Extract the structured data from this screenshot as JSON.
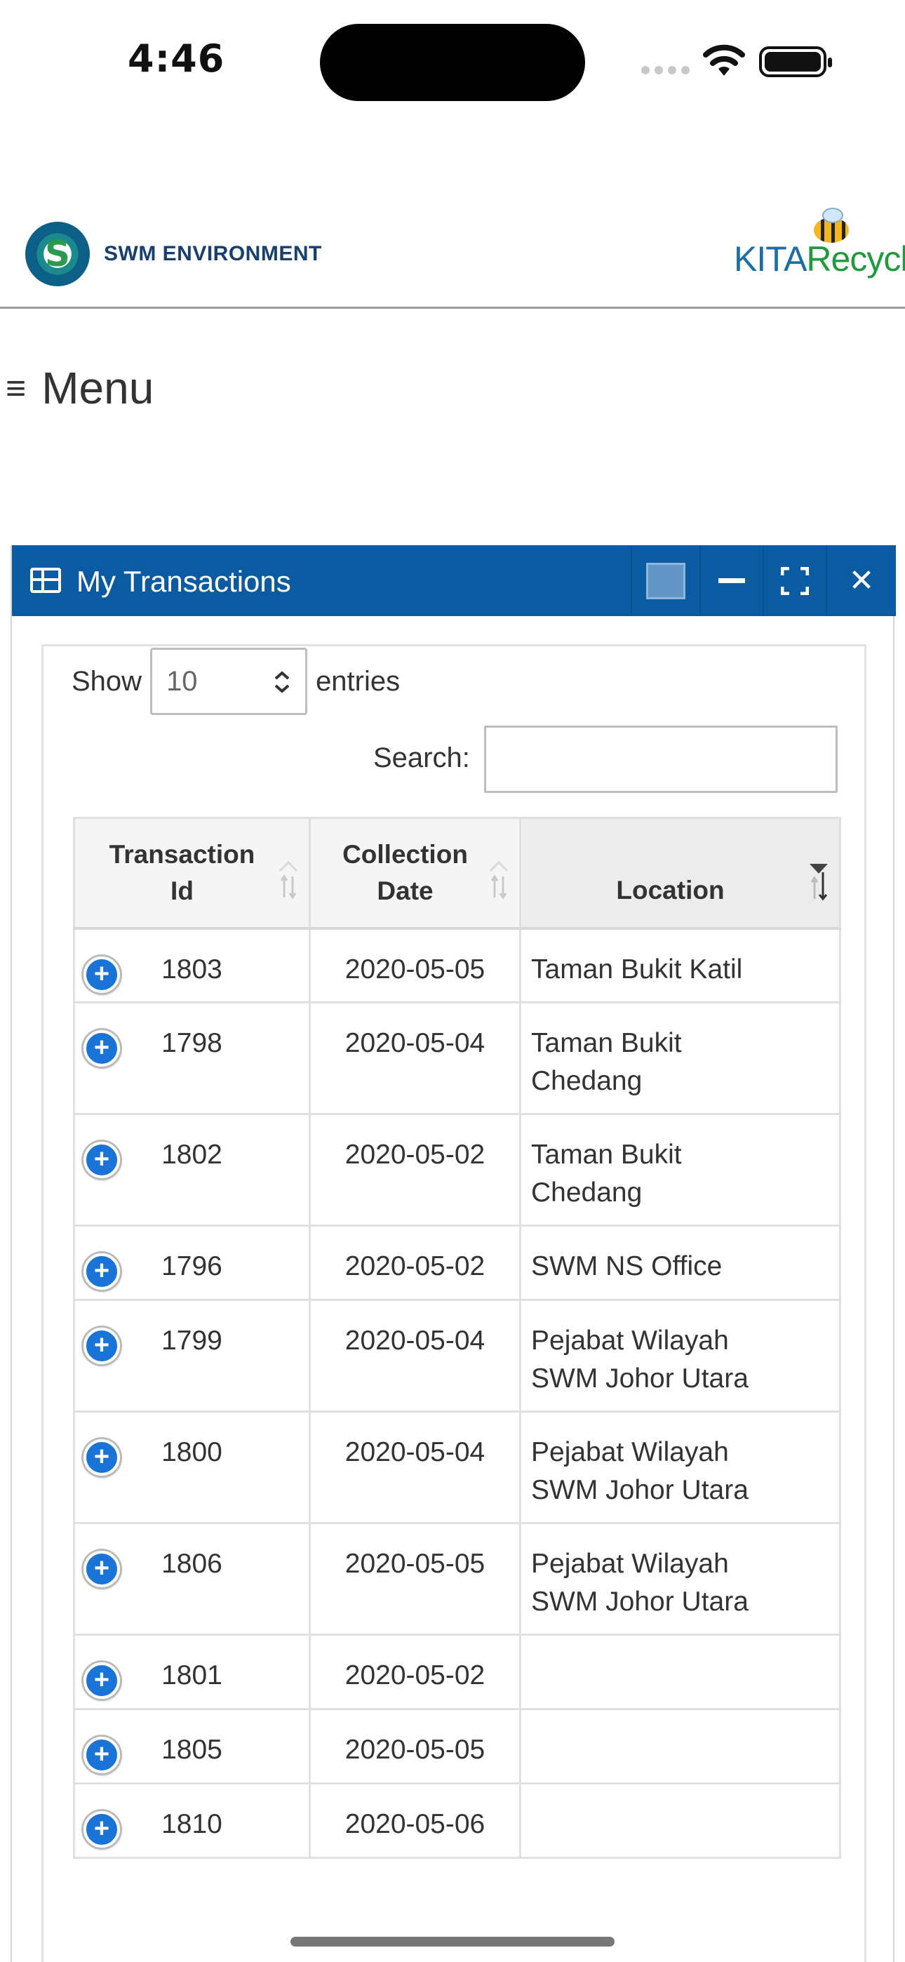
{
  "status_bar": {
    "time": "4:46"
  },
  "brand": {
    "left_logo_text": "SWM ENVIRONMENT",
    "right_logo_part1": "KITA",
    "right_logo_part2": "Recycle"
  },
  "menu": {
    "icon": "hamburger-icon",
    "label": "Menu"
  },
  "panel": {
    "title": "My Transactions",
    "header_color": "#0a5ba1",
    "controls": [
      "color-swatch",
      "minimize-icon",
      "maximize-icon",
      "close-icon"
    ]
  },
  "datatable": {
    "show_label": "Show",
    "page_length": "10",
    "entries_label": "entries",
    "search_label": "Search:",
    "search_value": "",
    "columns": [
      {
        "label_line1": "Transaction",
        "label_line2": "Id"
      },
      {
        "label_line1": "Collection",
        "label_line2": "Date"
      },
      {
        "label_line1": "Location",
        "label_line2": ""
      }
    ],
    "rows": [
      {
        "id": "1803",
        "date": "2020-05-05",
        "location_line1": "Taman Bukit Katil",
        "location_line2": ""
      },
      {
        "id": "1798",
        "date": "2020-05-04",
        "location_line1": "Taman Bukit",
        "location_line2": "Chedang"
      },
      {
        "id": "1802",
        "date": "2020-05-02",
        "location_line1": "Taman Bukit",
        "location_line2": "Chedang"
      },
      {
        "id": "1796",
        "date": "2020-05-02",
        "location_line1": "SWM NS Office",
        "location_line2": ""
      },
      {
        "id": "1799",
        "date": "2020-05-04",
        "location_line1": "Pejabat Wilayah",
        "location_line2": "SWM Johor Utara"
      },
      {
        "id": "1800",
        "date": "2020-05-04",
        "location_line1": "Pejabat Wilayah",
        "location_line2": "SWM Johor Utara"
      },
      {
        "id": "1806",
        "date": "2020-05-05",
        "location_line1": "Pejabat Wilayah",
        "location_line2": "SWM Johor Utara"
      },
      {
        "id": "1801",
        "date": "2020-05-02",
        "location_line1": "",
        "location_line2": ""
      },
      {
        "id": "1805",
        "date": "2020-05-05",
        "location_line1": "",
        "location_line2": ""
      },
      {
        "id": "1810",
        "date": "2020-05-06",
        "location_line1": "",
        "location_line2": ""
      }
    ]
  }
}
